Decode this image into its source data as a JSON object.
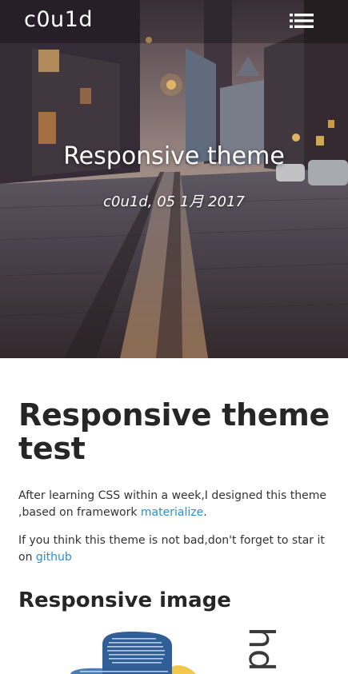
{
  "navbar": {
    "brand": "c0u1d",
    "menu_icon": "list-menu-icon"
  },
  "hero": {
    "title": "Responsive theme",
    "meta": "c0u1d, 05 1月 2017"
  },
  "post": {
    "title": "Responsive theme test",
    "paragraph1": {
      "text": "After learning CSS within a week,I designed this theme ,based on framework ",
      "link": "materialize",
      "suffix": "."
    },
    "paragraph2": {
      "text": "If you think this theme is not bad,don't forget to star it on ",
      "link": "github"
    },
    "section_title": "Responsive image",
    "figure": {
      "side_text": "hd"
    }
  },
  "colors": {
    "link": "#2a8fd0",
    "heading": "#262626",
    "body_text": "#333333"
  }
}
